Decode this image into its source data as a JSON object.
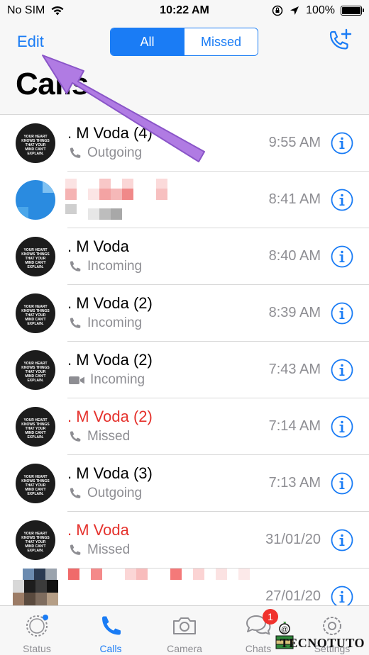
{
  "status_bar": {
    "carrier": "No SIM",
    "time": "10:22 AM",
    "battery": "100%"
  },
  "nav": {
    "edit_label": "Edit",
    "segments": [
      "All",
      "Missed"
    ],
    "title": "Calls"
  },
  "calls": [
    {
      "name": ". M Voda  (4)",
      "type": "Outgoing",
      "time": "9:55 AM",
      "missed": false,
      "icon": "phone-icon"
    },
    {
      "name": "",
      "type": "",
      "time": "8:41 AM",
      "missed": false,
      "icon": "phone-icon"
    },
    {
      "name": ". M Voda",
      "type": "Incoming",
      "time": "8:40 AM",
      "missed": false,
      "icon": "phone-icon"
    },
    {
      "name": ". M Voda  (2)",
      "type": "Incoming",
      "time": "8:39 AM",
      "missed": false,
      "icon": "phone-icon"
    },
    {
      "name": ". M Voda  (2)",
      "type": "Incoming",
      "time": "7:43 AM",
      "missed": false,
      "icon": "video-camera-icon"
    },
    {
      "name": ". M Voda  (2)",
      "type": "Missed",
      "time": "7:14 AM",
      "missed": true,
      "icon": "phone-icon"
    },
    {
      "name": ". M Voda  (3)",
      "type": "Outgoing",
      "time": "7:13 AM",
      "missed": false,
      "icon": "phone-icon"
    },
    {
      "name": ". M Voda",
      "type": "Missed",
      "time": "31/01/20",
      "missed": true,
      "icon": "phone-icon"
    },
    {
      "name": "",
      "type": "",
      "time": "27/01/20",
      "missed": false,
      "icon": "phone-icon"
    }
  ],
  "tabs": [
    {
      "label": "Status",
      "icon": "status-ring-icon",
      "active": false
    },
    {
      "label": "Calls",
      "icon": "phone-icon",
      "active": true
    },
    {
      "label": "Camera",
      "icon": "camera-icon",
      "active": false
    },
    {
      "label": "Chats",
      "icon": "chat-bubbles-icon",
      "active": false,
      "badge": "1"
    },
    {
      "label": "Settings",
      "icon": "gear-icon",
      "active": false
    }
  ],
  "watermark": "TECNOTUTO",
  "colors": {
    "accent": "#1a7cf5",
    "missed": "#e5322d",
    "secondary_text": "#8e8e93",
    "annotation_arrow": "#b07be3"
  }
}
